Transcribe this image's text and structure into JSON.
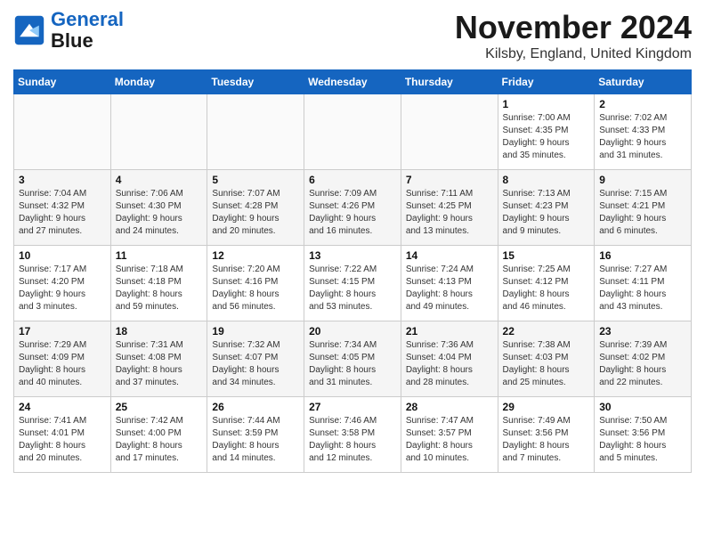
{
  "header": {
    "logo_line1": "General",
    "logo_line2": "Blue",
    "month": "November 2024",
    "location": "Kilsby, England, United Kingdom"
  },
  "weekdays": [
    "Sunday",
    "Monday",
    "Tuesday",
    "Wednesday",
    "Thursday",
    "Friday",
    "Saturday"
  ],
  "weeks": [
    [
      {
        "day": "",
        "info": ""
      },
      {
        "day": "",
        "info": ""
      },
      {
        "day": "",
        "info": ""
      },
      {
        "day": "",
        "info": ""
      },
      {
        "day": "",
        "info": ""
      },
      {
        "day": "1",
        "info": "Sunrise: 7:00 AM\nSunset: 4:35 PM\nDaylight: 9 hours\nand 35 minutes."
      },
      {
        "day": "2",
        "info": "Sunrise: 7:02 AM\nSunset: 4:33 PM\nDaylight: 9 hours\nand 31 minutes."
      }
    ],
    [
      {
        "day": "3",
        "info": "Sunrise: 7:04 AM\nSunset: 4:32 PM\nDaylight: 9 hours\nand 27 minutes."
      },
      {
        "day": "4",
        "info": "Sunrise: 7:06 AM\nSunset: 4:30 PM\nDaylight: 9 hours\nand 24 minutes."
      },
      {
        "day": "5",
        "info": "Sunrise: 7:07 AM\nSunset: 4:28 PM\nDaylight: 9 hours\nand 20 minutes."
      },
      {
        "day": "6",
        "info": "Sunrise: 7:09 AM\nSunset: 4:26 PM\nDaylight: 9 hours\nand 16 minutes."
      },
      {
        "day": "7",
        "info": "Sunrise: 7:11 AM\nSunset: 4:25 PM\nDaylight: 9 hours\nand 13 minutes."
      },
      {
        "day": "8",
        "info": "Sunrise: 7:13 AM\nSunset: 4:23 PM\nDaylight: 9 hours\nand 9 minutes."
      },
      {
        "day": "9",
        "info": "Sunrise: 7:15 AM\nSunset: 4:21 PM\nDaylight: 9 hours\nand 6 minutes."
      }
    ],
    [
      {
        "day": "10",
        "info": "Sunrise: 7:17 AM\nSunset: 4:20 PM\nDaylight: 9 hours\nand 3 minutes."
      },
      {
        "day": "11",
        "info": "Sunrise: 7:18 AM\nSunset: 4:18 PM\nDaylight: 8 hours\nand 59 minutes."
      },
      {
        "day": "12",
        "info": "Sunrise: 7:20 AM\nSunset: 4:16 PM\nDaylight: 8 hours\nand 56 minutes."
      },
      {
        "day": "13",
        "info": "Sunrise: 7:22 AM\nSunset: 4:15 PM\nDaylight: 8 hours\nand 53 minutes."
      },
      {
        "day": "14",
        "info": "Sunrise: 7:24 AM\nSunset: 4:13 PM\nDaylight: 8 hours\nand 49 minutes."
      },
      {
        "day": "15",
        "info": "Sunrise: 7:25 AM\nSunset: 4:12 PM\nDaylight: 8 hours\nand 46 minutes."
      },
      {
        "day": "16",
        "info": "Sunrise: 7:27 AM\nSunset: 4:11 PM\nDaylight: 8 hours\nand 43 minutes."
      }
    ],
    [
      {
        "day": "17",
        "info": "Sunrise: 7:29 AM\nSunset: 4:09 PM\nDaylight: 8 hours\nand 40 minutes."
      },
      {
        "day": "18",
        "info": "Sunrise: 7:31 AM\nSunset: 4:08 PM\nDaylight: 8 hours\nand 37 minutes."
      },
      {
        "day": "19",
        "info": "Sunrise: 7:32 AM\nSunset: 4:07 PM\nDaylight: 8 hours\nand 34 minutes."
      },
      {
        "day": "20",
        "info": "Sunrise: 7:34 AM\nSunset: 4:05 PM\nDaylight: 8 hours\nand 31 minutes."
      },
      {
        "day": "21",
        "info": "Sunrise: 7:36 AM\nSunset: 4:04 PM\nDaylight: 8 hours\nand 28 minutes."
      },
      {
        "day": "22",
        "info": "Sunrise: 7:38 AM\nSunset: 4:03 PM\nDaylight: 8 hours\nand 25 minutes."
      },
      {
        "day": "23",
        "info": "Sunrise: 7:39 AM\nSunset: 4:02 PM\nDaylight: 8 hours\nand 22 minutes."
      }
    ],
    [
      {
        "day": "24",
        "info": "Sunrise: 7:41 AM\nSunset: 4:01 PM\nDaylight: 8 hours\nand 20 minutes."
      },
      {
        "day": "25",
        "info": "Sunrise: 7:42 AM\nSunset: 4:00 PM\nDaylight: 8 hours\nand 17 minutes."
      },
      {
        "day": "26",
        "info": "Sunrise: 7:44 AM\nSunset: 3:59 PM\nDaylight: 8 hours\nand 14 minutes."
      },
      {
        "day": "27",
        "info": "Sunrise: 7:46 AM\nSunset: 3:58 PM\nDaylight: 8 hours\nand 12 minutes."
      },
      {
        "day": "28",
        "info": "Sunrise: 7:47 AM\nSunset: 3:57 PM\nDaylight: 8 hours\nand 10 minutes."
      },
      {
        "day": "29",
        "info": "Sunrise: 7:49 AM\nSunset: 3:56 PM\nDaylight: 8 hours\nand 7 minutes."
      },
      {
        "day": "30",
        "info": "Sunrise: 7:50 AM\nSunset: 3:56 PM\nDaylight: 8 hours\nand 5 minutes."
      }
    ]
  ]
}
